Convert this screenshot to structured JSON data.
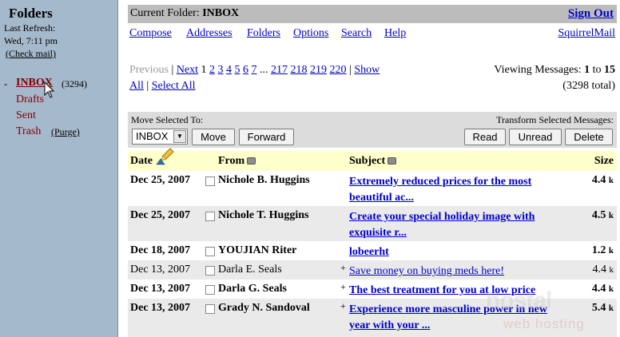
{
  "sidebar": {
    "title": "Folders",
    "last_refresh_label": "Last Refresh:",
    "last_refresh_time": "Wed, 7:11 pm",
    "check_mail": "(Check mail)",
    "inbox_prefix": "-",
    "folders": [
      {
        "label": "INBOX",
        "count": "(3294)"
      },
      {
        "label": "Drafts"
      },
      {
        "label": "Sent"
      },
      {
        "label": "Trash",
        "extra": "(Purge)"
      }
    ]
  },
  "header": {
    "current_folder_label": "Current Folder:",
    "current_folder": "INBOX",
    "sign_out": "Sign Out"
  },
  "menu": {
    "compose": "Compose",
    "addresses": "Addresses",
    "folders": "Folders",
    "options": "Options",
    "search": "Search",
    "help": "Help",
    "brand": "SquirrelMail"
  },
  "pager": {
    "previous": "Previous",
    "sep1": "|",
    "next": "Next",
    "sep2": "|",
    "current_page": "1",
    "pages": [
      "2",
      "3",
      "4",
      "5",
      "6",
      "7"
    ],
    "ellipsis": "...",
    "more_pages": [
      "217",
      "218",
      "219",
      "220"
    ],
    "sep3": "|",
    "show": "Show",
    "all": "All",
    "sep4": "|",
    "select_all": "Select All",
    "viewing_prefix": "Viewing Messages:",
    "viewing_from": "1",
    "viewing_to_word": "to",
    "viewing_to": "15",
    "total": "(3298 total)"
  },
  "actions": {
    "move_selected_to": "Move Selected To:",
    "transform_selected": "Transform Selected Messages:",
    "folder_select_value": "INBOX",
    "move": "Move",
    "forward": "Forward",
    "read": "Read",
    "unread": "Unread",
    "delete": "Delete"
  },
  "table": {
    "columns": {
      "date": "Date",
      "from": "From",
      "subject": "Subject",
      "size": "Size"
    },
    "rows": [
      {
        "date": "Dec 25, 2007",
        "from": "Nichole B. Huggins",
        "subject": "Extremely reduced prices for the most beautiful ac...",
        "size": "4.4",
        "unit": "k"
      },
      {
        "date": "Dec 25, 2007",
        "from": "Nichole T. Huggins",
        "subject": "Create your special holiday image with exquisite r...",
        "size": "4.5",
        "unit": "k"
      },
      {
        "date": "Dec 18, 2007",
        "from": "YOUJIAN Riter",
        "subject": "lobeerht",
        "size": "1.2",
        "unit": "k"
      },
      {
        "date": "Dec 13, 2007",
        "from": "Darla E. Seals",
        "subject": "Save money on buying meds here!",
        "size": "4.4",
        "unit": "k",
        "plus": "+"
      },
      {
        "date": "Dec 13, 2007",
        "from": "Darla G. Seals",
        "subject": "The best treatment for you at low price",
        "size": "4.4",
        "unit": "k",
        "plus": "+"
      },
      {
        "date": "Dec 13, 2007",
        "from": "Grady N. Sandoval",
        "subject": "Experience more masculine power in new year with your ...",
        "size": "5.4",
        "unit": "k",
        "plus": "+"
      }
    ]
  },
  "watermark": {
    "line1": "hostal",
    "line2": "web hosting"
  },
  "colors": {
    "sidebar_bg": "#a5b9cc",
    "folder_text": "#800000",
    "link": "#0000cc",
    "header_bar": "#bcbcbc",
    "table_header": "#ffffcc",
    "row_shade": "#eaeaea"
  }
}
